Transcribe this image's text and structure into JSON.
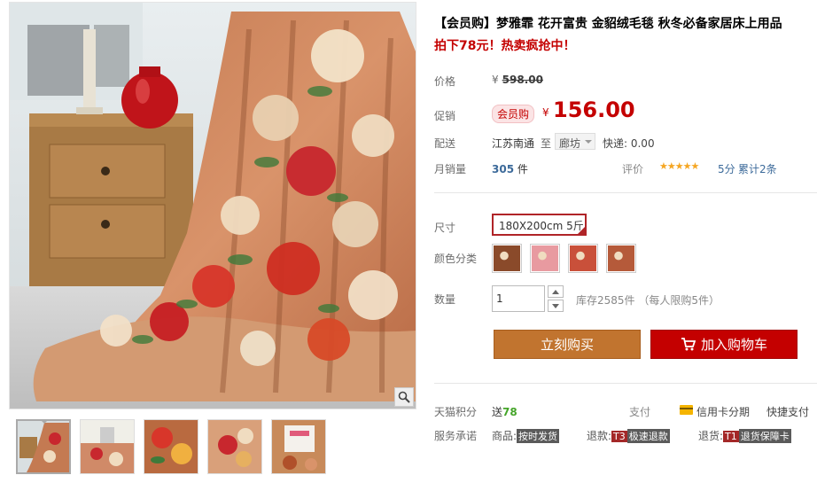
{
  "product": {
    "title": "【会员购】梦雅霏 花开富贵 金貂绒毛毯 秋冬必备家居床上用品",
    "subtitle": "拍下78元！热卖疯抢中！"
  },
  "price": {
    "label": "价格",
    "currency": "¥",
    "original": "598.00"
  },
  "promo": {
    "label": "促销",
    "badge": "会员购",
    "currency": "¥",
    "price": "156.00"
  },
  "shipping": {
    "label": "配送",
    "from": "江苏南通",
    "to_label": "至",
    "destination": "廊坊",
    "fee": "快递: 0.00"
  },
  "sales": {
    "label": "月销量",
    "count": "305",
    "unit": "件",
    "rating_label": "评价",
    "stars": "★★★★★",
    "score": "5分",
    "reviews": "累计2条"
  },
  "options": {
    "size_label": "尺寸",
    "size_value": "180X200cm 5斤",
    "color_label": "颜色分类",
    "swatch_colors": [
      "#8a4a2a",
      "#e89aa0",
      "#c9503a",
      "#b55a3a"
    ]
  },
  "quantity": {
    "label": "数量",
    "value": "1",
    "stock": "库存2585件 （每人限购5件）"
  },
  "actions": {
    "buy_now": "立刻购买",
    "add_to_cart": "加入购物车"
  },
  "extras": {
    "points_label": "天猫积分",
    "points_prefix": "送",
    "points_value": "78",
    "pay_label": "支付",
    "installment": "信用卡分期",
    "quickpay": "快捷支付",
    "service_label": "服务承诺",
    "svc1_prefix": "商品:",
    "svc1_tag": "按时发货",
    "svc2_prefix": "退款:",
    "svc2_code": "T3",
    "svc2_tag": "极速退款",
    "svc3_prefix": "退货:",
    "svc3_code": "T1",
    "svc3_tag": "退货保障卡"
  },
  "colors": {
    "accent_red": "#c40000",
    "buy_orange": "#c1742f",
    "link_blue": "#3c6a9a"
  }
}
